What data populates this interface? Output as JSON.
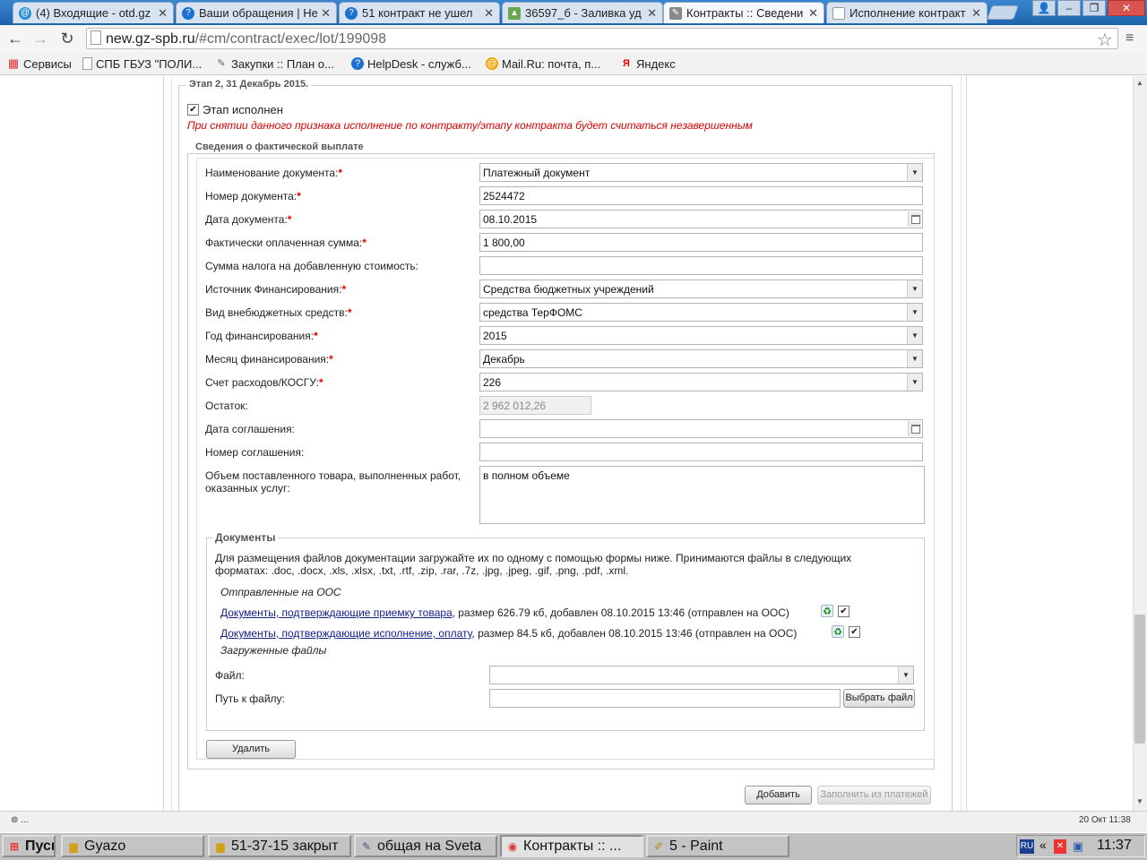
{
  "browser": {
    "tabs": [
      {
        "label": "(4) Входящие - otd.gz",
        "icon": "mail-icon",
        "active": false
      },
      {
        "label": "Ваши обращения | Не",
        "icon": "helpdesk-icon",
        "active": false
      },
      {
        "label": "51 контракт не ушел",
        "icon": "helpdesk-icon",
        "active": false
      },
      {
        "label": "36597_б - Заливка уд",
        "icon": "image-icon",
        "active": false
      },
      {
        "label": "Контракты :: Сведени",
        "icon": "tools-icon",
        "active": true
      },
      {
        "label": "Исполнение контракт",
        "icon": "page-icon",
        "active": false
      }
    ],
    "tab_close": "✕",
    "url_host": "new.gz-spb.ru",
    "url_path": "/#cm/contract/exec/lot/199098",
    "bookmarks": [
      {
        "label": "Сервисы",
        "icon": "apps-icon"
      },
      {
        "label": "СПБ ГБУЗ \"ПОЛИ...",
        "icon": "page-icon"
      },
      {
        "label": "Закупки :: План о...",
        "icon": "tools-icon"
      },
      {
        "label": "HelpDesk - служб...",
        "icon": "helpdesk-icon"
      },
      {
        "label": "Mail.Ru: почта, п...",
        "icon": "mail-icon"
      },
      {
        "label": "Яндекс",
        "icon": "yandex-icon"
      }
    ]
  },
  "stage": {
    "legend": "Этап 2, 31 Декабрь 2015.",
    "completed_label": "Этап исполнен",
    "completed_checked": true,
    "warning": "При снятии данного признака исполнение по контракту/этапу контракта будет считаться незавершенным"
  },
  "payment": {
    "legend": "Сведения о фактической выплате",
    "fields": {
      "doc_name": {
        "label": "Наименование документа:",
        "value": "Платежный документ"
      },
      "doc_number": {
        "label": "Номер документа:",
        "value": "2524472"
      },
      "doc_date": {
        "label": "Дата документа:",
        "value": "08.10.2015"
      },
      "paid_sum": {
        "label": "Фактически оплаченная сумма:",
        "value": "1 800,00"
      },
      "vat": {
        "label": "Сумма налога на добавленную стоимость:",
        "value": ""
      },
      "fin_source": {
        "label": "Источник Финансирования:",
        "value": "Средства бюджетных учреждений"
      },
      "offbudget": {
        "label": "Вид внебюджетных средств:",
        "value": "средства ТерФОМС"
      },
      "fin_year": {
        "label": "Год финансирования:",
        "value": "2015"
      },
      "fin_month": {
        "label": "Месяц финансирования:",
        "value": "Декабрь"
      },
      "kosgu": {
        "label": "Счет расходов/КОСГУ:",
        "value": "226"
      },
      "balance": {
        "label": "Остаток:",
        "value": "2 962 012,26"
      },
      "agreement_date": {
        "label": "Дата соглашения:",
        "value": ""
      },
      "agreement_number": {
        "label": "Номер соглашения:",
        "value": ""
      },
      "volume": {
        "label_line1": "Объем поставленного товара, выполненных работ,",
        "label_line2": "оказанных услуг:",
        "value": "в полном объеме"
      }
    }
  },
  "documents": {
    "legend": "Документы",
    "info_line1": "Для размещения файлов документации загружайте их по одному с помощью формы ниже. Принимаются файлы в следующих",
    "info_line2": "форматах: .doc, .docx, .xls, .xlsx, .txt, .rtf, .zip, .rar, .7z, .jpg, .jpeg, .gif, .png, .pdf, .xml.",
    "sent_title": "Отправленные на ООС",
    "files": [
      {
        "link": "Документы, подтверждающие приемку товара",
        "info": ", размер 626.79 кб, добавлен 08.10.2015 13:46 (отправлен на ООС)"
      },
      {
        "link": "Документы, подтверждающие исполнение, оплату",
        "info": ", размер 84.5 кб, добавлен 08.10.2015 13:46 (отправлен на ООС)"
      }
    ],
    "uploaded_title": "Загруженные файлы",
    "file_label": "Файл:",
    "file_value": "",
    "path_label": "Путь к файлу:",
    "path_value": "",
    "choose_button": "Выбрать файл"
  },
  "buttons": {
    "delete": "Удалить",
    "add": "Добавить",
    "fill_from_payments": "Заполнить из платежей"
  },
  "statusbar": {
    "left": "⊚ ...",
    "right": "20 Окт 11:38"
  },
  "taskbar": {
    "start": "Пуск",
    "tasks": [
      {
        "label": "Gyazo",
        "icon": "folder-icon",
        "active": false
      },
      {
        "label": "51-37-15 закрыт",
        "icon": "folder-icon",
        "active": false
      },
      {
        "label": "общая на Sveta",
        "icon": "document-icon",
        "active": false
      },
      {
        "label": "Контракты :: ...",
        "icon": "chrome-icon",
        "active": true
      },
      {
        "label": "5 - Paint",
        "icon": "paint-icon",
        "active": false
      }
    ],
    "lang": "RU",
    "clock": "11:37"
  }
}
